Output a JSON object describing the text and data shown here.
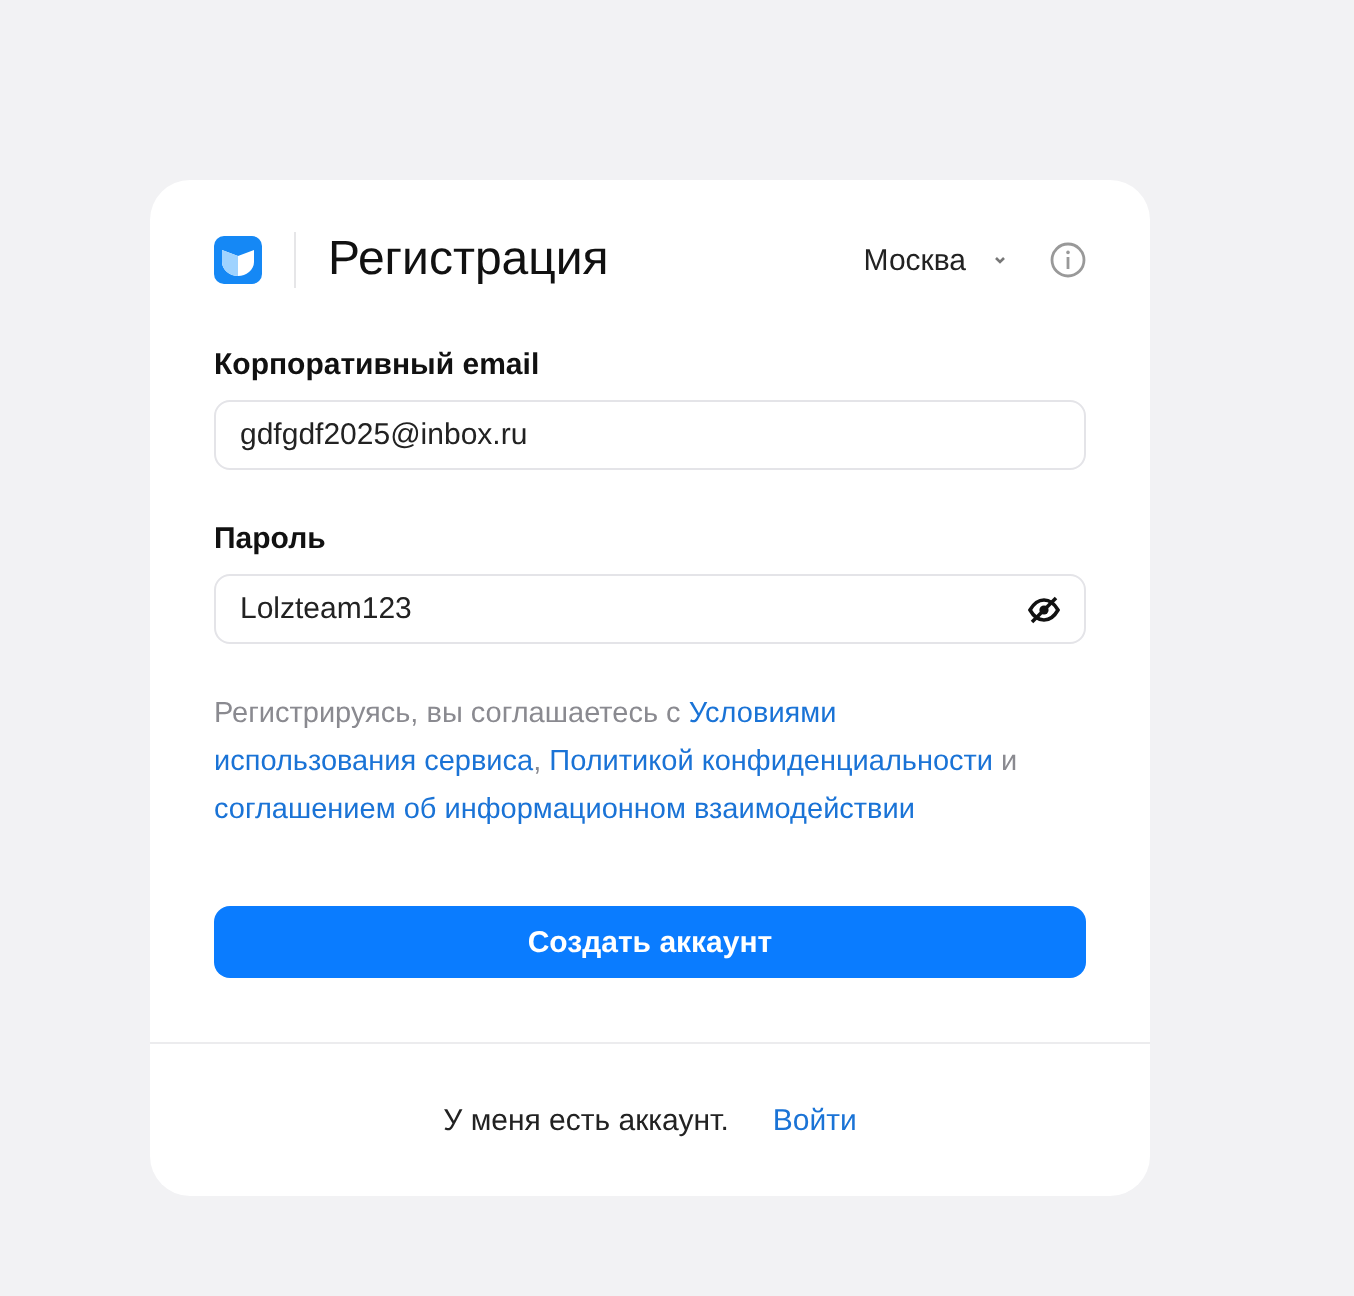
{
  "header": {
    "title": "Регистрация",
    "city": "Москва"
  },
  "fields": [
    {
      "label": "Корпоративный email",
      "value": "gdfgdf2025@inbox.ru",
      "kind": "text"
    },
    {
      "label": "Пароль",
      "value": "Lolzteam123",
      "kind": "password"
    }
  ],
  "consent": [
    {
      "kind": "text",
      "text": "Регистрируясь, вы соглашаетесь с "
    },
    {
      "kind": "link",
      "text": "Условиями"
    },
    {
      "kind": "link",
      "text": "использования сервиса"
    },
    {
      "kind": "text",
      "text": ", "
    },
    {
      "kind": "link",
      "text": "Политикой конфиденциальности"
    },
    {
      "kind": "text",
      "text": " и "
    },
    {
      "kind": "link",
      "text": "соглашением об информационном взаимодействии"
    }
  ],
  "submit": "Создать аккаунт",
  "footer": {
    "text": "У меня есть аккаунт.",
    "link": "Войти"
  }
}
